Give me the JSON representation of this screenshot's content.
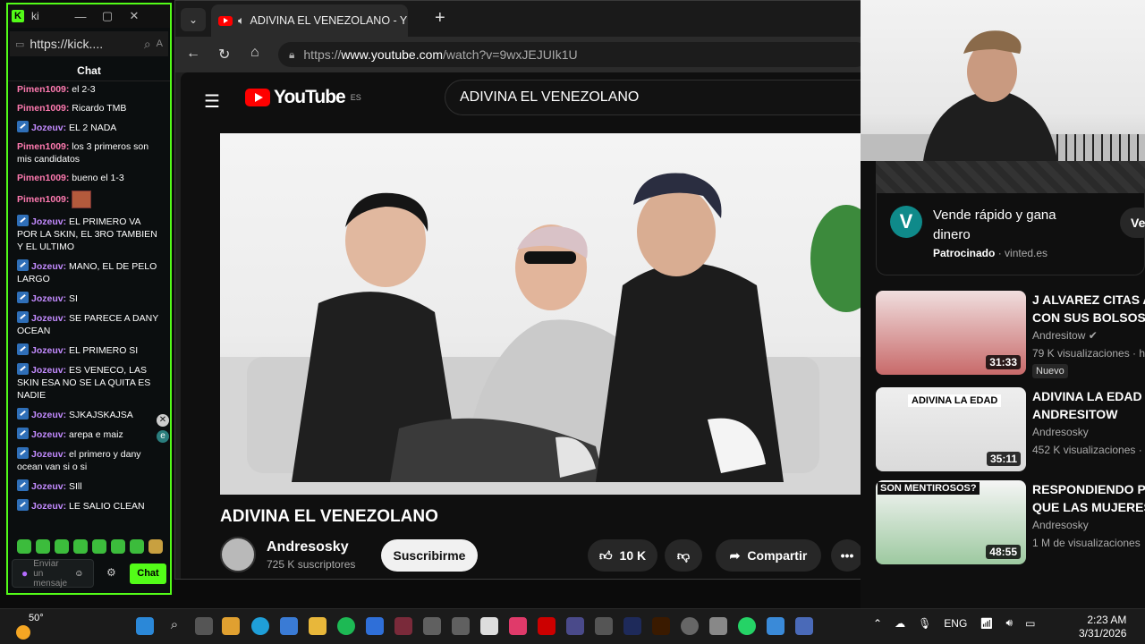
{
  "kick": {
    "title": "ki",
    "url": "https://kick....",
    "chat_label": "Chat",
    "messages": [
      {
        "user": "Pimen1009:",
        "text": "el 2-3",
        "badge": false
      },
      {
        "user": "Pimen1009:",
        "text": "Ricardo TMB",
        "badge": false
      },
      {
        "user": "Jozeuv:",
        "text": "EL 2 NADA",
        "badge": true
      },
      {
        "user": "Pimen1009:",
        "text": "los 3 primeros son mis candidatos",
        "badge": false
      },
      {
        "user": "Pimen1009:",
        "text": "bueno el 1-3",
        "badge": false
      },
      {
        "user": "Pimen1009:",
        "text": "",
        "badge": false,
        "emote": true
      },
      {
        "user": "Jozeuv:",
        "text": "EL PRIMERO VA POR LA SKIN, EL 3RO TAMBIEN Y EL ULTIMO",
        "badge": true
      },
      {
        "user": "Jozeuv:",
        "text": "MANO, EL DE PELO LARGO",
        "badge": true
      },
      {
        "user": "Jozeuv:",
        "text": "SI",
        "badge": true
      },
      {
        "user": "Jozeuv:",
        "text": "SE PARECE A DANY OCEAN",
        "badge": true
      },
      {
        "user": "Jozeuv:",
        "text": "EL PRIMERO SI",
        "badge": true
      },
      {
        "user": "Jozeuv:",
        "text": "ES VENECO, LAS SKIN ESA NO SE LA QUITA ES NADIE",
        "badge": true
      },
      {
        "user": "Jozeuv:",
        "text": "SJKAJSKAJSA",
        "badge": true
      },
      {
        "user": "Jozeuv:",
        "text": "arepa e maiz",
        "badge": true
      },
      {
        "user": "Jozeuv:",
        "text": "el primero y dany ocean van si o si",
        "badge": true
      },
      {
        "user": "Jozeuv:",
        "text": "SIll",
        "badge": true
      },
      {
        "user": "Jozeuv:",
        "text": "LE SALIO CLEAN",
        "badge": true
      }
    ],
    "send_placeholder": "Enviar un mensaje",
    "chat_button": "Chat"
  },
  "browser": {
    "tab_title": "ADIVINA EL VENEZOLANO - Y",
    "url_prefix": "https://",
    "url_host": "www.youtube.com",
    "url_path": "/watch?v=9wxJEJUIk1U"
  },
  "youtube": {
    "logo_text": "YouTube",
    "region": "ES",
    "search_value": "ADIVINA EL VENEZOLANO",
    "video_title": "ADIVINA EL VENEZOLANO",
    "channel": "Andresosky",
    "subscribers": "725 K suscriptores",
    "subscribe": "Suscribirme",
    "likes": "10 K",
    "share": "Compartir"
  },
  "ad": {
    "logo_letter": "V",
    "title": "Vende rápido y gana dinero",
    "sponsored": "Patrocinado",
    "domain": "vinted.es",
    "button": "Ve"
  },
  "recs": [
    {
      "title1": "J ALVAREZ CITAS A",
      "title2": "CON SUS BOLSOS",
      "channel": "Andresitow",
      "meta": "79 K visualizaciones · h",
      "duration": "31:33",
      "badge": "Nuevo",
      "verified": true
    },
    {
      "title1": "ADIVINA LA EDAD -",
      "title2": "ANDRESITOW",
      "channel": "Andresosky",
      "meta": "452 K visualizaciones ·",
      "duration": "35:11",
      "thumb_text": "ADIVINA LA EDAD"
    },
    {
      "title1": "RESPONDIENDO PR",
      "title2": "QUE LAS MUJERES",
      "channel": "Andresosky",
      "meta": "1 M de visualizaciones",
      "duration": "48:55",
      "thumb_text": "SON MENTIROSOS?"
    }
  ],
  "taskbar": {
    "temp": "50°",
    "lang": "ENG",
    "time": "2:23 AM",
    "date": "3/31/2026"
  },
  "colors": {
    "kick_green": "#53fc18",
    "yt_red": "#ff0000",
    "accent": "#ff7ab0"
  }
}
